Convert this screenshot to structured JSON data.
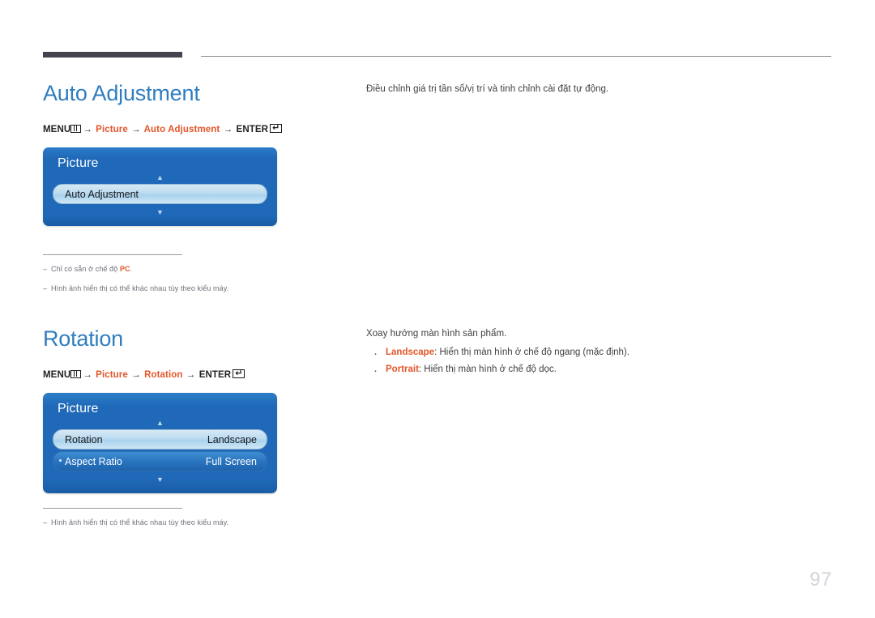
{
  "header": {
    "rule_color": "#43434f"
  },
  "sections": [
    {
      "id": "auto-adjustment",
      "title": "Auto Adjustment",
      "path": {
        "menu_label": "MENU",
        "menu_icon": "menu-bars-icon",
        "arrow": "→",
        "step1": "Picture",
        "step2": "Auto Adjustment",
        "enter_label": "ENTER",
        "enter_icon": "enter-return-icon"
      },
      "osd": {
        "title": "Picture",
        "up_arrow": "▲",
        "down_arrow": "▼",
        "rows": [
          {
            "label": "Auto Adjustment",
            "value": "",
            "selected": true,
            "has_dot": false
          }
        ]
      },
      "notes": [
        {
          "prefix": "–",
          "text_before": "Chỉ có sẵn ở chế độ ",
          "accent": "PC",
          "text_after": "."
        },
        {
          "prefix": "–",
          "text_before": "Hình ảnh hiển thị có thể khác nhau tùy theo kiểu máy.",
          "accent": "",
          "text_after": ""
        }
      ],
      "description": "Điều chỉnh giá trị tần số/vị trí và tinh chỉnh cài đặt tự động.",
      "bullets": []
    },
    {
      "id": "rotation",
      "title": "Rotation",
      "path": {
        "menu_label": "MENU",
        "menu_icon": "menu-bars-icon",
        "arrow": "→",
        "step1": "Picture",
        "step2": "Rotation",
        "enter_label": "ENTER",
        "enter_icon": "enter-return-icon"
      },
      "osd": {
        "title": "Picture",
        "up_arrow": "▲",
        "down_arrow": "▼",
        "rows": [
          {
            "label": "Rotation",
            "value": "Landscape",
            "selected": true,
            "has_dot": false
          },
          {
            "label": "Aspect Ratio",
            "value": "Full Screen",
            "selected": false,
            "has_dot": true
          }
        ]
      },
      "notes": [
        {
          "prefix": "–",
          "text_before": "Hình ảnh hiển thị có thể khác nhau tùy theo kiểu máy.",
          "accent": "",
          "text_after": ""
        }
      ],
      "description": "Xoay hướng màn hình sản phẩm.",
      "bullets": [
        {
          "term": "Landscape",
          "text": ": Hiển thị màn hình ở chế độ ngang (mặc định)."
        },
        {
          "term": "Portrait",
          "text": ": Hiển thị màn hình ở chế độ dọc."
        }
      ]
    }
  ],
  "footer": {
    "page_number": "97"
  },
  "colors": {
    "heading": "#2f7dc0",
    "accent": "#e2562a",
    "osd_blue": "#1f69b8",
    "page_number": "#d2d2d8"
  }
}
